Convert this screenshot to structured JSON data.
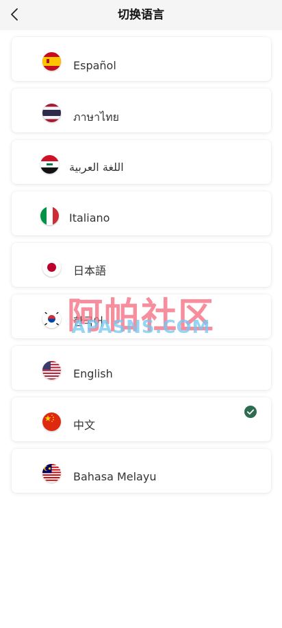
{
  "header": {
    "title": "切换语言",
    "back_icon": "chevron-left-icon"
  },
  "languages": [
    {
      "label": "Español",
      "flag": "spain-flag-icon",
      "selected": false
    },
    {
      "label": "ภาษาไทย",
      "flag": "thailand-flag-icon",
      "selected": false
    },
    {
      "label": "اللغة العربية",
      "flag": "iraq-flag-icon",
      "selected": false
    },
    {
      "label": "Italiano",
      "flag": "italy-flag-icon",
      "selected": false
    },
    {
      "label": "日本語",
      "flag": "japan-flag-icon",
      "selected": false
    },
    {
      "label": "한국어",
      "flag": "south-korea-flag-icon",
      "selected": false
    },
    {
      "label": "English",
      "flag": "usa-flag-icon",
      "selected": false
    },
    {
      "label": "中文",
      "flag": "china-flag-icon",
      "selected": true
    },
    {
      "label": "Bahasa Melayu",
      "flag": "malaysia-flag-icon",
      "selected": false
    }
  ],
  "selected_icon": "check-circle-icon",
  "watermark": {
    "cn": "阿帕社区",
    "en": "APASNS.COM"
  },
  "colors": {
    "header_bg": "#f5f5f5",
    "check": "#2e6b4f",
    "text": "#333333"
  }
}
